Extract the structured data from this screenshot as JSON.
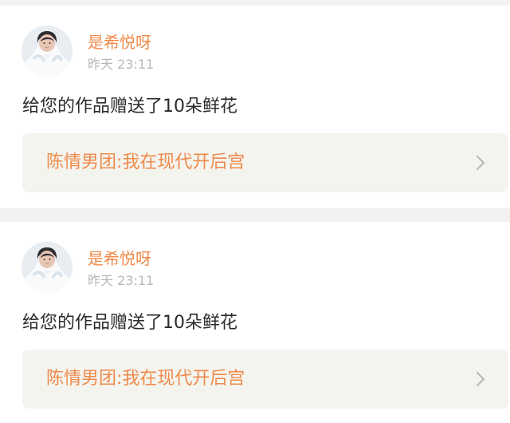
{
  "notifications": [
    {
      "username": "是希悦呀",
      "timestamp": "昨天 23:11",
      "message": "给您的作品赠送了10朵鲜花",
      "work_title": "陈情男团:我在现代开后宫",
      "avatar_icon": "user-avatar-photo",
      "arrow_icon": "chevron-right-icon"
    },
    {
      "username": "是希悦呀",
      "timestamp": "昨天 23:11",
      "message": "给您的作品赠送了10朵鲜花",
      "work_title": "陈情男团:我在现代开后宫",
      "avatar_icon": "user-avatar-photo",
      "arrow_icon": "chevron-right-icon"
    }
  ],
  "colors": {
    "accent": "#ef8a4a",
    "text": "#2b2b2b",
    "muted": "#b7b7b7",
    "link_background": "#f4f4ef",
    "page_background": "#f2f2f2"
  }
}
